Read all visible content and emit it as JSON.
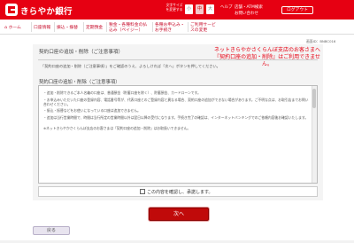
{
  "header": {
    "bank_name": "きらやか銀行",
    "font_size_label": "文字サイズを変更する",
    "font_sizes": [
      "小",
      "中",
      "大"
    ],
    "help_link": "ヘルプ",
    "shop_link": "店舗・ATM検索",
    "inquiry_link": "お問い合わせ",
    "logout_label": "ログアウト"
  },
  "nav": {
    "items": [
      "ホーム",
      "口座情報",
      "振込・振替",
      "定期預金",
      "税金・各種料金の払込み（ペイジー）",
      "各種お申込み・お手続き",
      "ご利用サービスの変更"
    ]
  },
  "screen_id": "画面ID：BNBC016",
  "page": {
    "title": "契約口座の追加・削除（ご注意事項）",
    "notice_line1": "ネットきらやかさくらんぼ支店のお客さまへ",
    "notice_line2": "『契約口座の追加・削除』はご利用できません。",
    "intro": "「契約口座の追加・削除（ご注意事項）」をご確認のうえ、よろしければ「次へ」ボタンを押してください。",
    "sub_title": "契約口座の追加・削除（ご注意事項）"
  },
  "terms": [
    "・追加・削除できるご本人名義の口座は、普通預金（貯蓄口座を除く）、貯蓄預金、カードローンです。",
    "・お申込みいただいた口座の登録内容、電話番号等が、代表口座とのご登録内容と異なる場合、契約口座の追加ができない場合があります。ご不明な点は、お取引店までお問い合わせください。",
    "・振込・振替などをお使いになっている口座は追加できません。",
    "・追加は当行営業時間で、時間は当行所定の営業時間以外は翌日以降の受付になります。手続き完了の確認は、インターネットバンキングでのご依頼内容後お確認いたします。",
    "※ネットきらやかさくらんぼ支店のお客さまは「契約口座の追加・削除」はお取扱いできません。"
  ],
  "confirm_label": "この内容を確認し、承諾します。",
  "next_label": "次へ",
  "back_label": "戻る",
  "colors": {
    "brand": "#e60012",
    "notice": "#e60012",
    "button": "#c00a0a"
  }
}
